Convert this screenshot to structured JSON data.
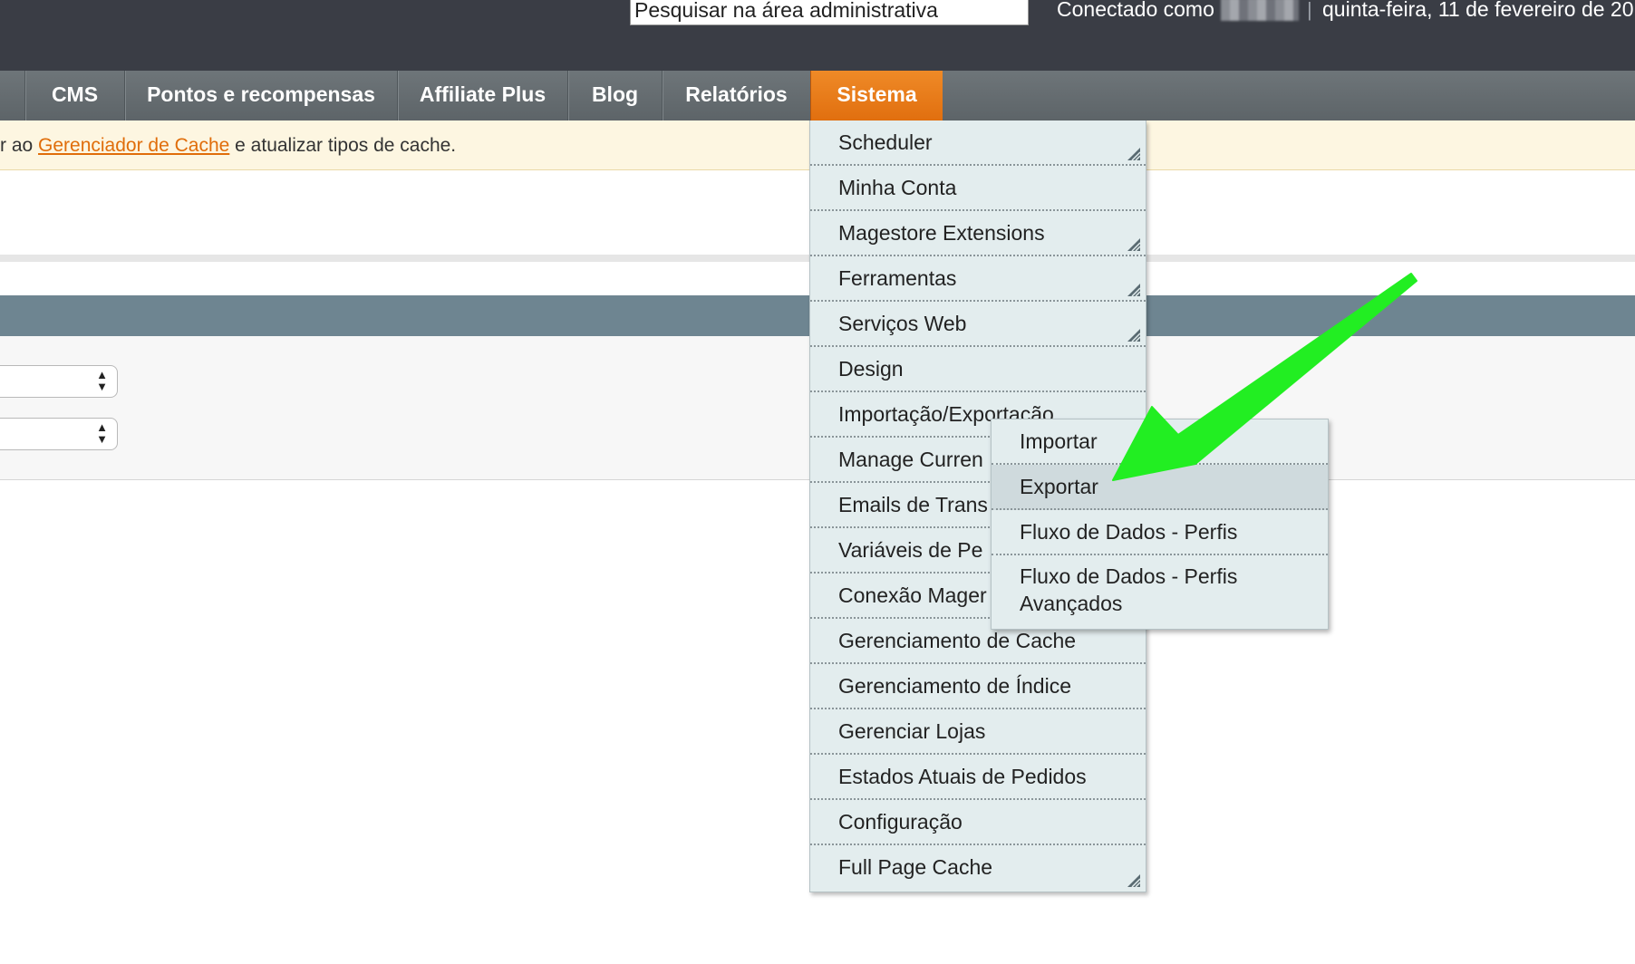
{
  "header": {
    "search_placeholder": "Pesquisar na área administrativa",
    "logged_label": "Conectado como",
    "separator": "|",
    "date": "quinta-feira, 11 de fevereiro de 20"
  },
  "nav": {
    "items": [
      {
        "label": "CMS"
      },
      {
        "label": "Pontos e recompensas"
      },
      {
        "label": "Affiliate Plus"
      },
      {
        "label": "Blog"
      },
      {
        "label": "Relatórios"
      },
      {
        "label": "Sistema",
        "active": true
      }
    ]
  },
  "notice": {
    "prefix": "r ao ",
    "link": "Gerenciador de Cache",
    "suffix": " e atualizar tipos de cache."
  },
  "system_menu": {
    "items": [
      {
        "label": "Scheduler",
        "has_children": true
      },
      {
        "label": "Minha Conta"
      },
      {
        "label": "Magestore Extensions",
        "has_children": true
      },
      {
        "label": "Ferramentas",
        "has_children": true
      },
      {
        "label": "Serviços Web",
        "has_children": true
      },
      {
        "label": "Design"
      },
      {
        "label": "Importação/Exportação"
      },
      {
        "label": "Manage Curren"
      },
      {
        "label": "Emails de Trans"
      },
      {
        "label": "Variáveis de Pe"
      },
      {
        "label": "Conexão Mager"
      },
      {
        "label": "Gerenciamento de Cache"
      },
      {
        "label": "Gerenciamento de Índice"
      },
      {
        "label": "Gerenciar Lojas"
      },
      {
        "label": "Estados Atuais de Pedidos"
      },
      {
        "label": "Configuração"
      },
      {
        "label": "Full Page Cache",
        "has_children": true
      }
    ]
  },
  "submenu": {
    "items": [
      {
        "label": "Importar"
      },
      {
        "label": "Exportar",
        "hover": true
      },
      {
        "label": "Fluxo de Dados - Perfis"
      },
      {
        "label": "Fluxo de Dados - Perfis",
        "label2": "Avançados"
      }
    ]
  },
  "annotation": {
    "arrow_color": "#22ee22"
  },
  "colors": {
    "header_bg": "#3a3d45",
    "nav_bg": "#666d71",
    "active_tab": "#e8790f",
    "menu_bg": "#e3edee",
    "notice_bg": "#fdf6e1",
    "link": "#e06d0a"
  }
}
